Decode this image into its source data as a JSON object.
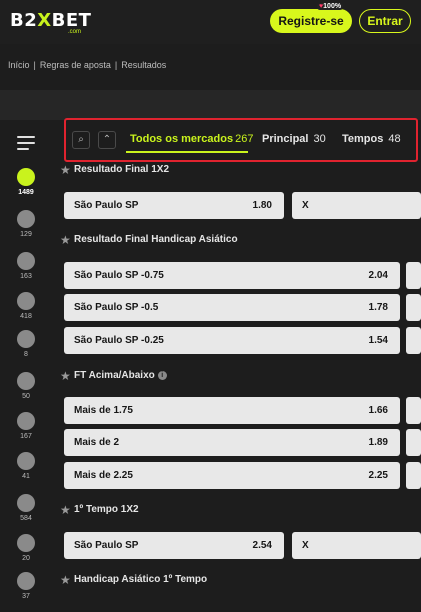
{
  "header": {
    "logo_prefix": "B2",
    "logo_x": "X",
    "logo_suffix": "BET",
    "logo_sub": ".com",
    "register_label": "Registre-se",
    "badge_label": "100%",
    "login_label": "Entrar"
  },
  "breadcrumb": {
    "items": [
      "Início",
      "Regras de aposta",
      "Resultados"
    ],
    "separator": "|"
  },
  "rail": {
    "sports": [
      {
        "icon": "soccer-icon",
        "count": "1489",
        "active": true
      },
      {
        "icon": "volleyball-icon",
        "count": "129",
        "active": false
      },
      {
        "icon": "basketball-icon",
        "count": "163",
        "active": false
      },
      {
        "icon": "tennis-icon",
        "count": "418",
        "active": false
      },
      {
        "icon": "racing-flag-icon",
        "count": "8",
        "active": false
      },
      {
        "icon": "hockey-icon",
        "count": "50",
        "active": false
      },
      {
        "icon": "gamepad-icon",
        "count": "167",
        "active": false
      },
      {
        "icon": "futsal-icon",
        "count": "41",
        "active": false
      },
      {
        "icon": "table-tennis-icon",
        "count": "584",
        "active": false
      },
      {
        "icon": "american-football-icon",
        "count": "20",
        "active": false
      },
      {
        "icon": "baseball-icon",
        "count": "37",
        "active": false
      }
    ]
  },
  "tabs": {
    "items": [
      {
        "label": "Todos os mercados",
        "count": "267",
        "active": true
      },
      {
        "label": "Principal",
        "count": "30",
        "active": false
      },
      {
        "label": "Tempos",
        "count": "48",
        "active": false
      }
    ]
  },
  "markets": [
    {
      "title": "Resultado Final 1X2"
    },
    {
      "title": "Resultado Final Handicap Asiático"
    },
    {
      "title": "FT Acima/Abaixo"
    },
    {
      "title": "1º Tempo 1X2"
    },
    {
      "title": "Handicap Asiático 1º Tempo"
    }
  ],
  "rows": {
    "r1": {
      "label": "São Paulo SP",
      "odd": "1.80",
      "side": "X"
    },
    "r2": {
      "label": "São Paulo SP  -0.75",
      "odd": "2.04"
    },
    "r3": {
      "label": "São Paulo SP  -0.5",
      "odd": "1.78"
    },
    "r4": {
      "label": "São Paulo SP  -0.25",
      "odd": "1.54"
    },
    "r5": {
      "label": "Mais de 1.75",
      "odd": "1.66"
    },
    "r6": {
      "label": "Mais de 2",
      "odd": "1.89"
    },
    "r7": {
      "label": "Mais de 2.25",
      "odd": "2.25"
    },
    "r8": {
      "label": "São Paulo SP",
      "odd": "2.54",
      "side": "X"
    }
  },
  "colors": {
    "accent": "#c9f31d",
    "highlight_border": "#e0232f",
    "background": "#1d1d1d",
    "row_bg": "#e8e8e8"
  }
}
